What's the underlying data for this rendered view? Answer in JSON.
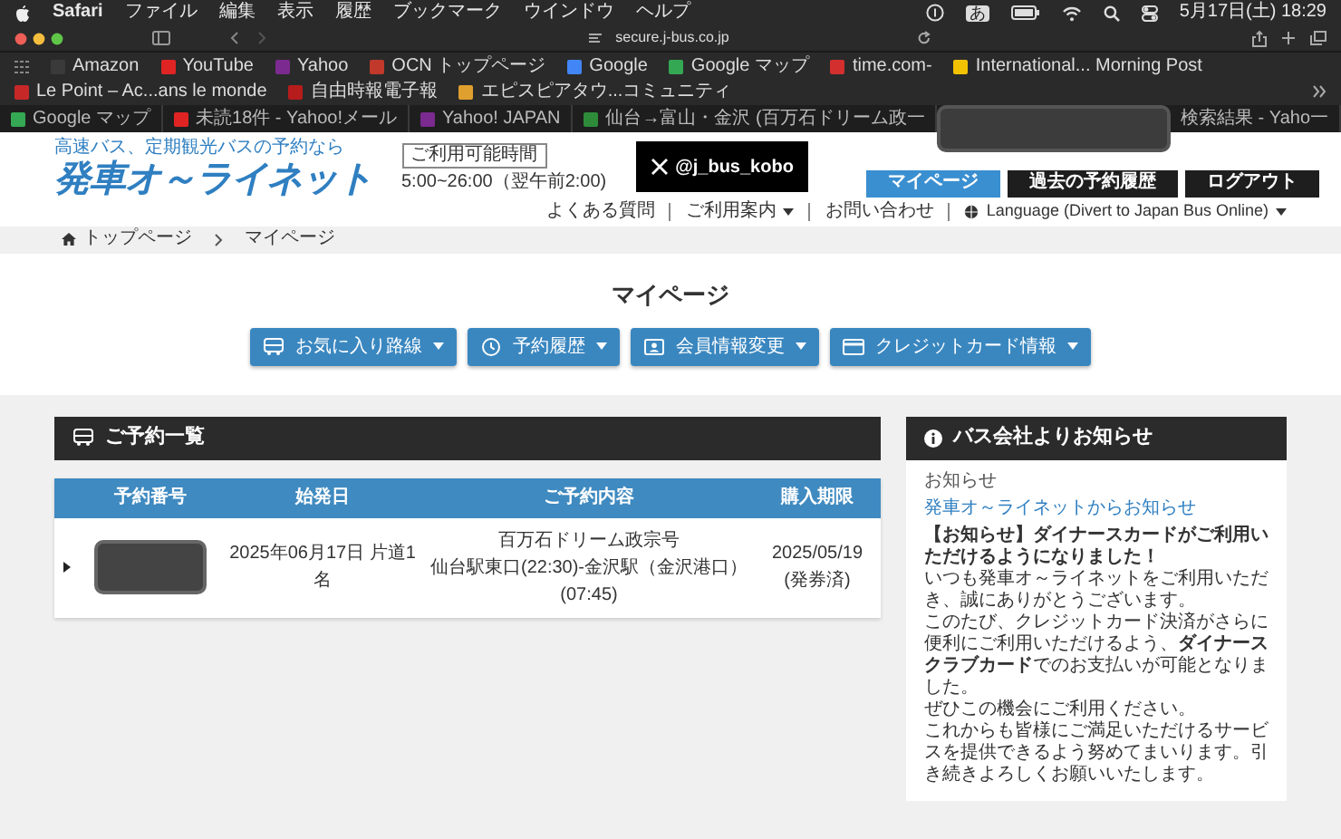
{
  "menubar": {
    "app": "Safari",
    "menus": [
      "ファイル",
      "編集",
      "表示",
      "履歴",
      "ブックマーク",
      "ウインドウ",
      "ヘルプ"
    ],
    "input_mode": "あ",
    "clock": "5月17日(土) 18:29"
  },
  "toolbar": {
    "address": "secure.j-bus.co.jp"
  },
  "bookmarks": [
    {
      "label": "Amazon",
      "color": "#3a3a3a"
    },
    {
      "label": "YouTube",
      "color": "#e02424"
    },
    {
      "label": "Yahoo",
      "color": "#7b2a8f"
    },
    {
      "label": "OCN トップページ",
      "color": "#c0392b"
    },
    {
      "label": "Google",
      "color": "#4285f4"
    },
    {
      "label": "Google マップ",
      "color": "#34a853"
    },
    {
      "label": "time.com-",
      "color": "#d32f2f"
    },
    {
      "label": "International... Morning Post",
      "color": "#f2c200"
    },
    {
      "label": "Le Point – Ac...ans le monde",
      "color": "#c62828"
    },
    {
      "label": "自由時報電子報",
      "color": "#b71c1c"
    },
    {
      "label": "エピスピアタウ...コミュニティ",
      "color": "#e0a030"
    }
  ],
  "tabs": [
    {
      "label": "Google マップ",
      "color": "#34a853"
    },
    {
      "label": "未読18件 - Yahoo!メール",
      "color": "#e02424"
    },
    {
      "label": "Yahoo! JAPAN",
      "color": "#7b2a8f"
    },
    {
      "label": "仙台→富山・金沢 (百万石ドリーム政一",
      "color": "#2e8b3a"
    },
    {
      "label": "検索結果 - Yaho一"
    }
  ],
  "header": {
    "tagline": "高速バス、定期観光バスの予約なら",
    "logo": "発車オ～ライネット",
    "hours": {
      "label": "ご利用可能時間",
      "time": "5:00~26:00（翌午前2:00)"
    },
    "x_account": "@j_bus_kobo",
    "nav_buttons": [
      {
        "label": "マイページ",
        "selected": true
      },
      {
        "label": "過去の予約履歴",
        "selected": false
      },
      {
        "label": "ログアウト",
        "selected": false
      }
    ],
    "links": [
      {
        "label": "よくある質問",
        "kind": "plain",
        "has_dropdown": false
      },
      {
        "label": "ご利用案内",
        "kind": "plain",
        "has_dropdown": true
      },
      {
        "label": "お問い合わせ",
        "kind": "plain",
        "has_dropdown": false
      },
      {
        "label": "Language (Divert to Japan Bus Online)",
        "kind": "language",
        "has_dropdown": true
      }
    ]
  },
  "breadcrumb": [
    "トップページ",
    "マイページ"
  ],
  "page_title": "マイページ",
  "menu_buttons": [
    {
      "label": "お気に入り路線",
      "kind": "bus"
    },
    {
      "label": "予約履歴",
      "kind": "clock"
    },
    {
      "label": "会員情報変更",
      "kind": "id"
    },
    {
      "label": "クレジットカード情報",
      "kind": "card"
    }
  ],
  "reservations": {
    "title": "ご予約一覧",
    "columns": [
      "予約番号",
      "始発日",
      "ご予約内容",
      "購入期限"
    ],
    "rows": [
      {
        "start_date": "2025年06月17日 片道1名",
        "content": [
          "百万石ドリーム政宗号",
          "仙台駅東口(22:30)-金沢駅（金沢港口）(07:45)"
        ],
        "deadline": [
          "2025/05/19",
          "(発券済)"
        ]
      }
    ]
  },
  "notice": {
    "title": "バス会社よりお知らせ",
    "category": "お知らせ",
    "link": "発車オ～ライネットからお知らせ",
    "paragraphs": [
      {
        "kind": "lead",
        "text": "【お知らせ】ダイナースカードがご利用いただけるようになりました！"
      },
      {
        "kind": "plain",
        "text": "いつも発車オ～ライネットをご利用いただき、誠にありがとうございます。"
      },
      {
        "kind": "plain",
        "text": "このたび、クレジットカード決済がさらに便利にご利用いただけるよう、**ダイナースクラブカード**でのお支払いが可能となりました。"
      },
      {
        "kind": "plain",
        "text": "ぜひこの機会にご利用ください。"
      },
      {
        "kind": "plain",
        "text": "これからも皆様にご満足いただけるサービスを提供できるよう努めてまいります。引き続きよろしくお願いいたします。"
      }
    ]
  }
}
